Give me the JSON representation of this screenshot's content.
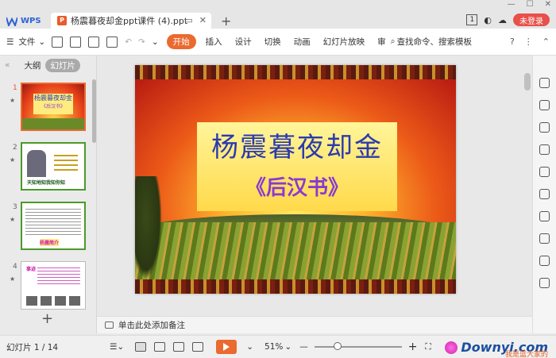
{
  "titlebar": {
    "app_name": "WPS",
    "doc_title": "杨震暮夜却金ppt课件 (4).ppt",
    "add_tab": "+",
    "badge": "1",
    "login": "未登录"
  },
  "menubar": {
    "file": "文件",
    "tabs": [
      "开始",
      "插入",
      "设计",
      "切换",
      "动画",
      "幻灯片放映",
      "审"
    ],
    "active_tab": "开始",
    "search": "查找命令、搜索模板"
  },
  "left_panel": {
    "tab_outline": "大纲",
    "tab_slides": "幻灯片",
    "slides": [
      {
        "num": "1",
        "title": "杨震暮夜却金",
        "sub": "《后汉书》"
      },
      {
        "num": "2",
        "caption": "天知地知我知你知"
      },
      {
        "num": "3",
        "caption": "杨震简介"
      },
      {
        "num": "4",
        "caption": "事迹"
      }
    ],
    "add_slide": "+"
  },
  "slide": {
    "title": "杨震暮夜却金",
    "subtitle": "《后汉书》"
  },
  "notes": {
    "placeholder": "单击此处添加备注"
  },
  "statusbar": {
    "slide_count": "幻灯片 1 / 14",
    "zoom": "51%",
    "zoom_fraction": 0.22
  },
  "watermark": {
    "text": "Downyi.com",
    "sub": "我是蓝大家的"
  },
  "colors": {
    "accent": "#ea6a2f",
    "login": "#e8504a",
    "wps_blue": "#2a62d4"
  }
}
